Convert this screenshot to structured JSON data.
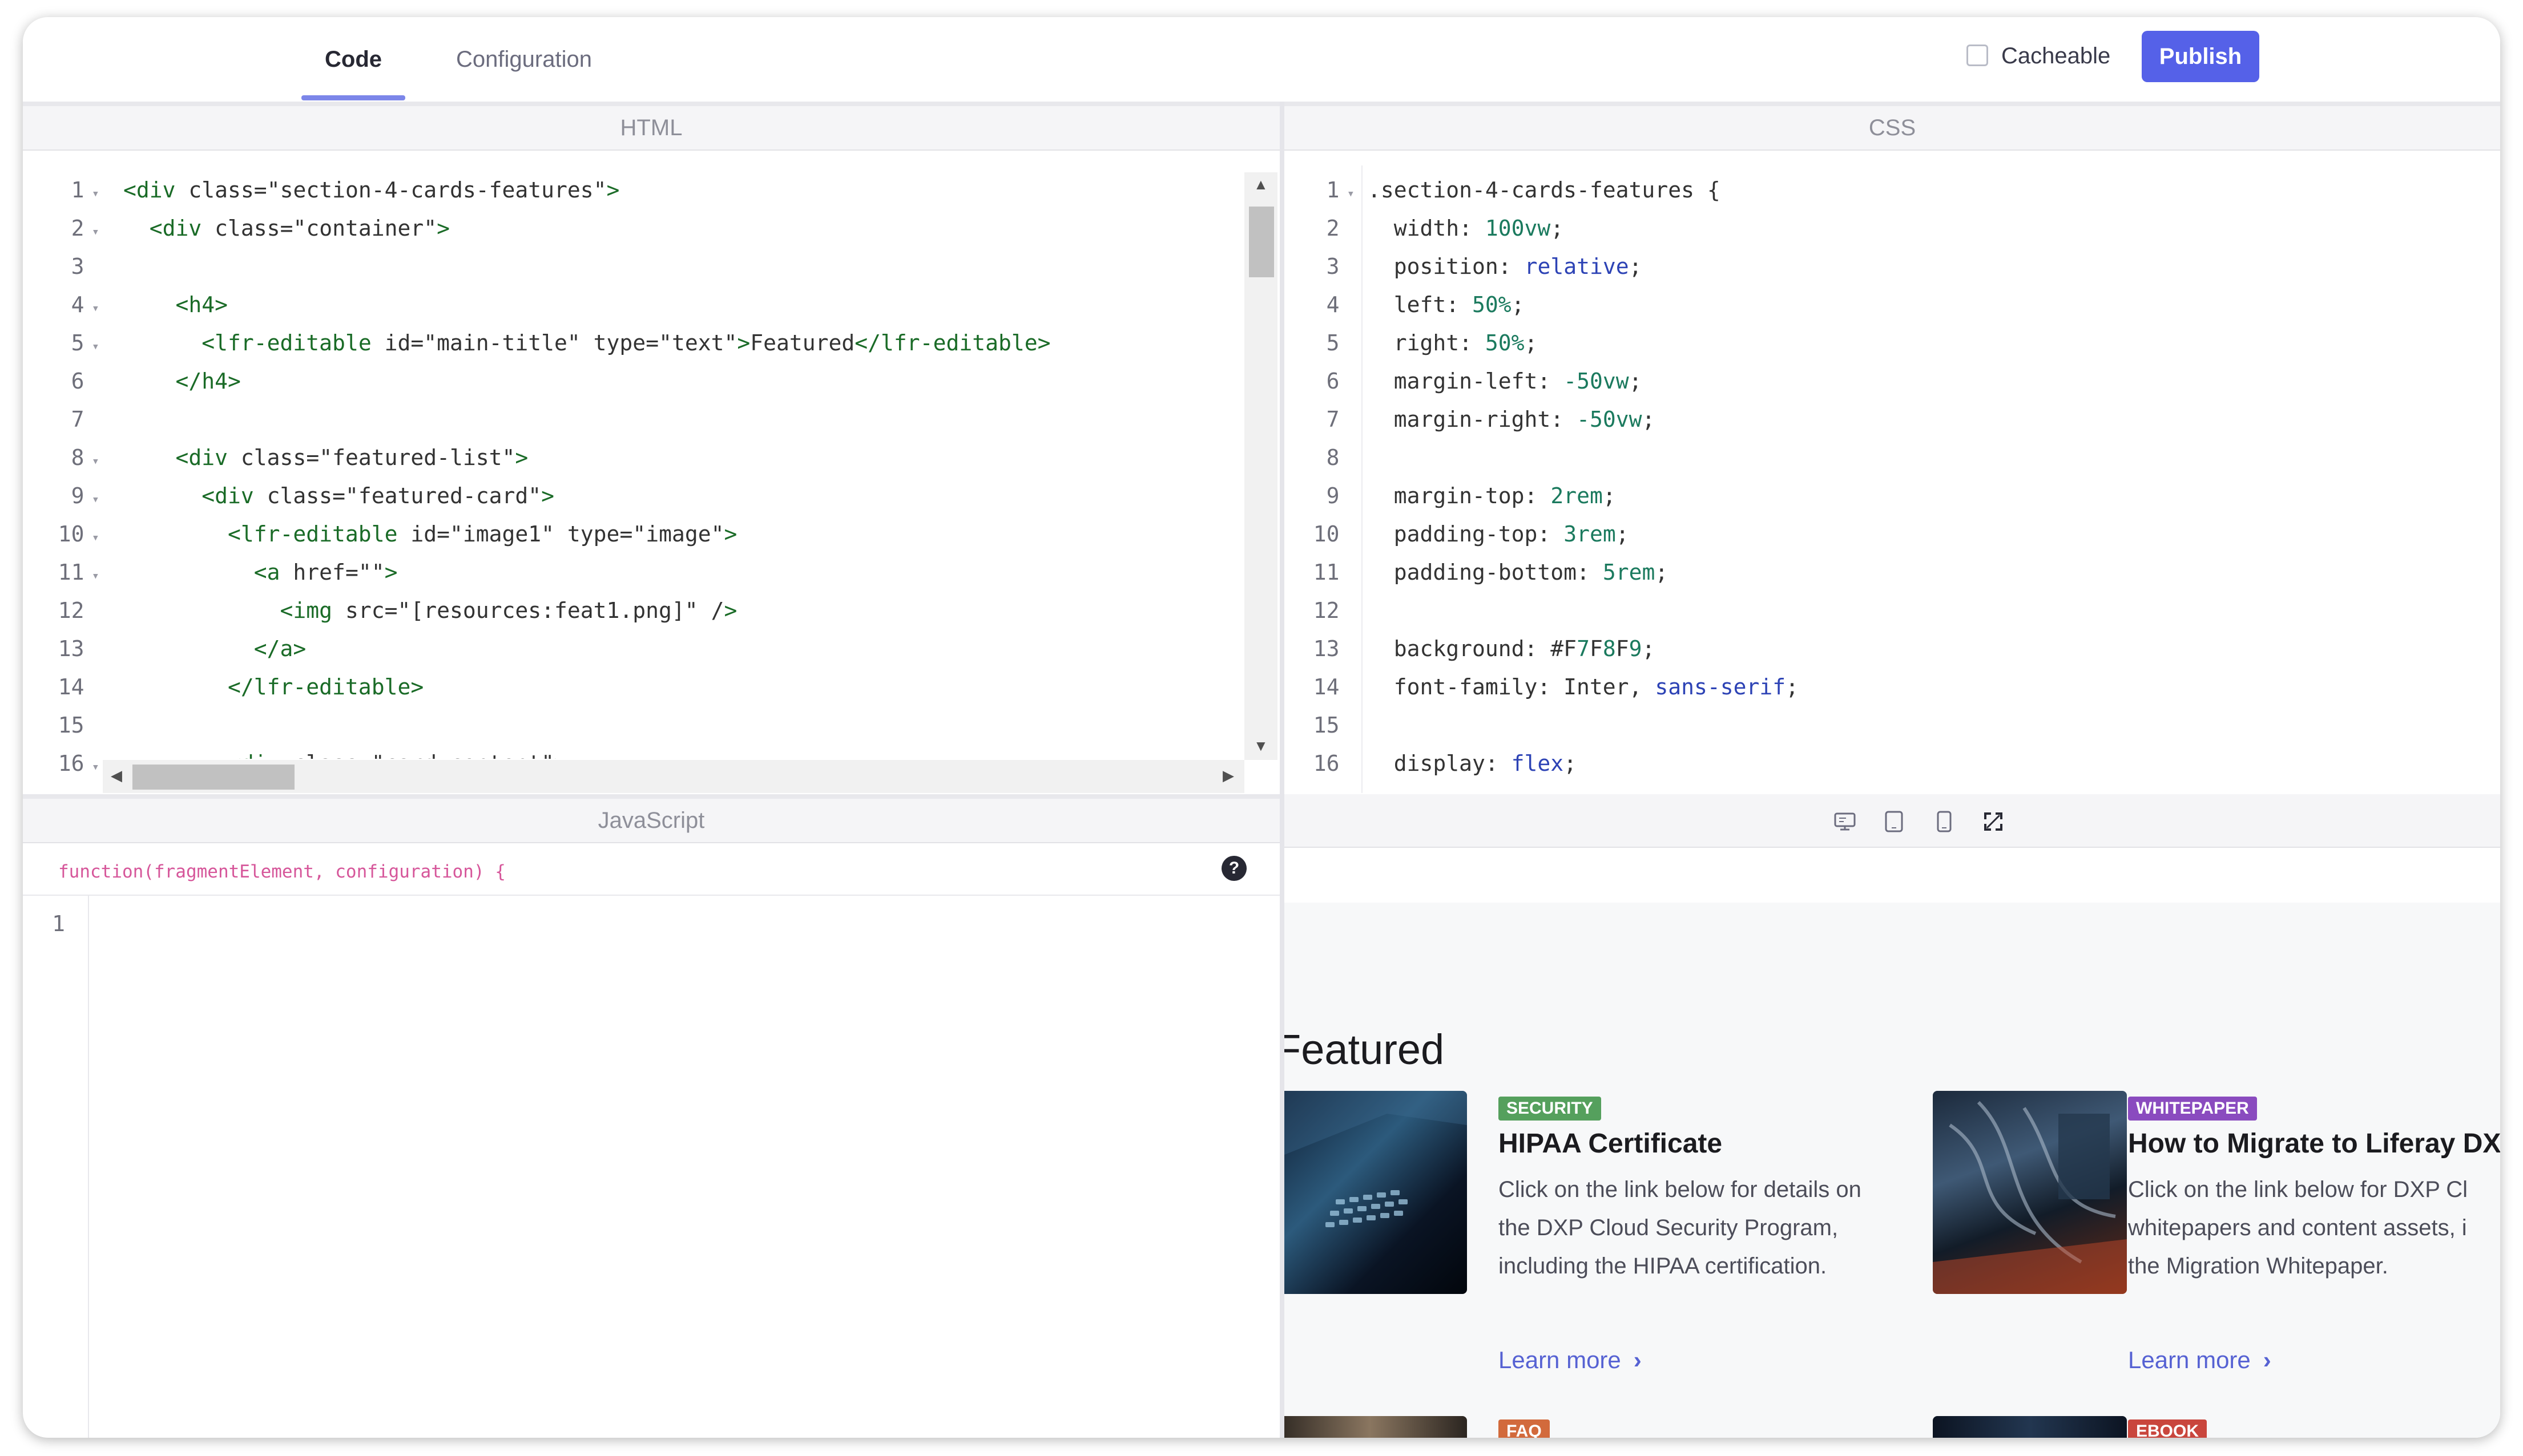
{
  "header": {
    "tabs": [
      {
        "label": "Code",
        "active": true
      },
      {
        "label": "Configuration",
        "active": false
      }
    ],
    "cacheable_label": "Cacheable",
    "cacheable_checked": false,
    "publish_label": "Publish"
  },
  "panels": {
    "html_title": "HTML",
    "css_title": "CSS",
    "js_title": "JavaScript"
  },
  "html_editor": {
    "line_numbers": [
      "1",
      "2",
      "3",
      "4",
      "5",
      "6",
      "7",
      "8",
      "9",
      "10",
      "11",
      "12",
      "13",
      "14",
      "15",
      "16"
    ],
    "lines": [
      "<div class=\"section-4-cards-features\">",
      "  <div class=\"container\">",
      "",
      "    <h4>",
      "      <lfr-editable id=\"main-title\" type=\"text\">Featured</lfr-editable>",
      "    </h4>",
      "",
      "    <div class=\"featured-list\">",
      "      <div class=\"featured-card\">",
      "        <lfr-editable id=\"image1\" type=\"image\">",
      "          <a href=\"\">",
      "            <img src=\"[resources:feat1.png]\" />",
      "          </a>",
      "        </lfr-editable>",
      "",
      "        <div class=\"card-content\">"
    ]
  },
  "css_editor": {
    "line_numbers": [
      "1",
      "2",
      "3",
      "4",
      "5",
      "6",
      "7",
      "8",
      "9",
      "10",
      "11",
      "12",
      "13",
      "14",
      "15",
      "16"
    ],
    "lines": [
      ".section-4-cards-features {",
      "  width: 100vw;",
      "  position: relative;",
      "  left: 50%;",
      "  right: 50%;",
      "  margin-left: -50vw;",
      "  margin-right: -50vw;",
      "",
      "  margin-top: 2rem;",
      "  padding-top: 3rem;",
      "  padding-bottom: 5rem;",
      "",
      "  background: #F7F8F9;",
      "  font-family: Inter, sans-serif;",
      "",
      "  display: flex;"
    ]
  },
  "js_editor": {
    "signature": "function(fragmentElement, configuration) {",
    "help_label": "?",
    "line_numbers": [
      "1"
    ]
  },
  "preview": {
    "toolbar_icons": [
      "desktop-icon",
      "tablet-icon",
      "mobile-icon",
      "autosize-icon"
    ],
    "title": "Featured",
    "cards": [
      {
        "badge": "SECURITY",
        "badge_color": "#55a05d",
        "title": "HIPAA Certificate",
        "text": "Click on the link below for details on the DXP Cloud Security Program, including the HIPAA certification.",
        "link": "Learn more"
      },
      {
        "badge": "WHITEPAPER",
        "badge_color": "#8a4bbf",
        "title": "How to Migrate to Liferay DX",
        "text": "Click on the link below for DXP Cl whitepapers and content assets, i the Migration Whitepaper.",
        "link": "Learn more"
      },
      {
        "badge": "FAQ",
        "badge_color": "#d26a3c"
      },
      {
        "badge": "EBOOK",
        "badge_color": "#c9463d"
      }
    ]
  },
  "colors": {
    "accent": "#5561e8",
    "tab_underline": "#7c86e9",
    "link": "#5662d3",
    "preview_bg": "#f7f8f9"
  }
}
